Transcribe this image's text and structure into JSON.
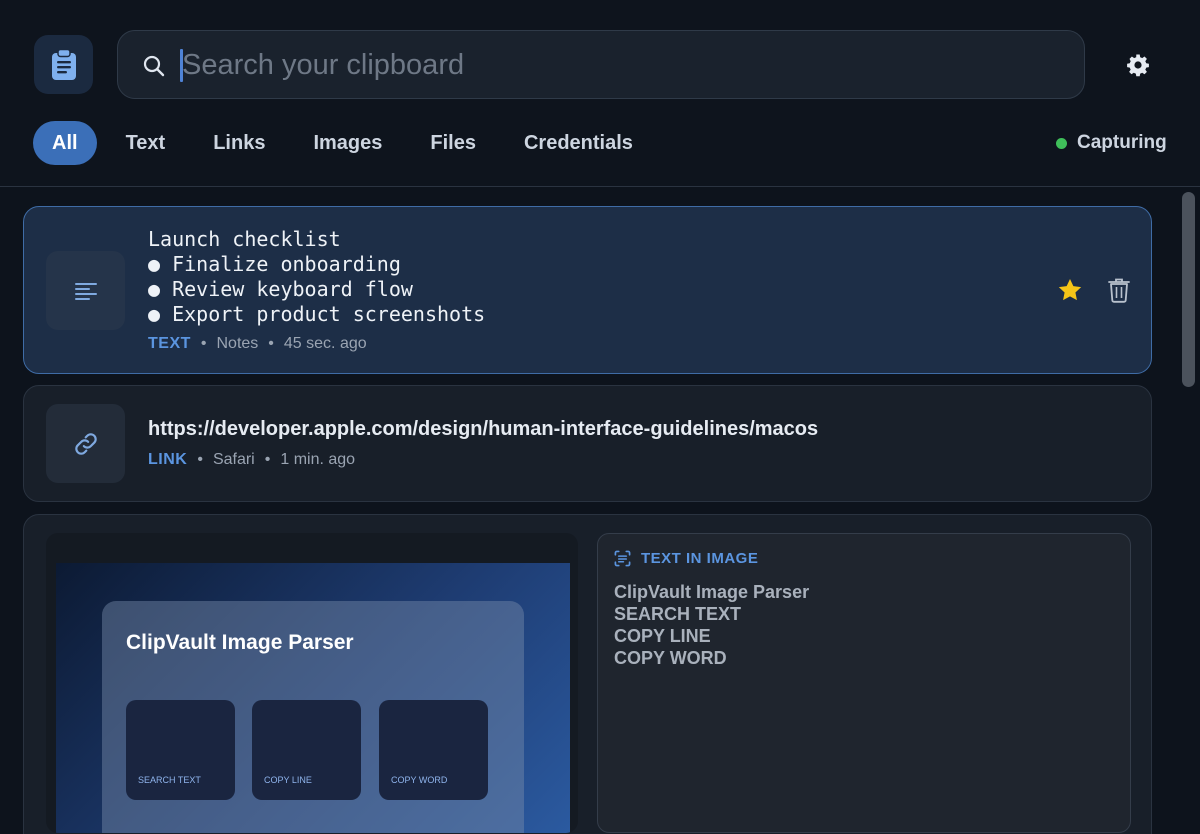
{
  "search": {
    "placeholder": "Search your clipboard",
    "value": ""
  },
  "tabs": [
    {
      "label": "All",
      "active": true
    },
    {
      "label": "Text"
    },
    {
      "label": "Links"
    },
    {
      "label": "Images"
    },
    {
      "label": "Files"
    },
    {
      "label": "Credentials"
    }
  ],
  "status": {
    "label": "Capturing",
    "color": "#3fbf5a"
  },
  "icons": {
    "app": "clipboard-icon",
    "search": "search-icon",
    "settings": "gear-icon"
  },
  "items": [
    {
      "lines": [
        "Launch checklist",
        "● Finalize onboarding",
        "● Review keyboard flow",
        "● Export product screenshots"
      ],
      "type": "TEXT",
      "source": "Notes",
      "time": "45 sec. ago",
      "starred": true,
      "icon": "text-lines-icon"
    },
    {
      "url": "https://developer.apple.com/design/human-interface-guidelines/macos",
      "type": "LINK",
      "source": "Safari",
      "time": "1 min. ago",
      "icon": "link-icon"
    },
    {
      "image": {
        "title": "ClipVault Image Parser",
        "buttons": [
          "SEARCH TEXT",
          "COPY LINE",
          "COPY WORD"
        ]
      },
      "ocr": {
        "heading": "TEXT IN IMAGE",
        "lines": [
          "ClipVault Image Parser",
          "SEARCH TEXT",
          "COPY LINE",
          "COPY WORD"
        ]
      }
    }
  ],
  "colors": {
    "accent": "#3b6fb8",
    "type_label": "#5b95e0",
    "star": "#f5c518"
  }
}
